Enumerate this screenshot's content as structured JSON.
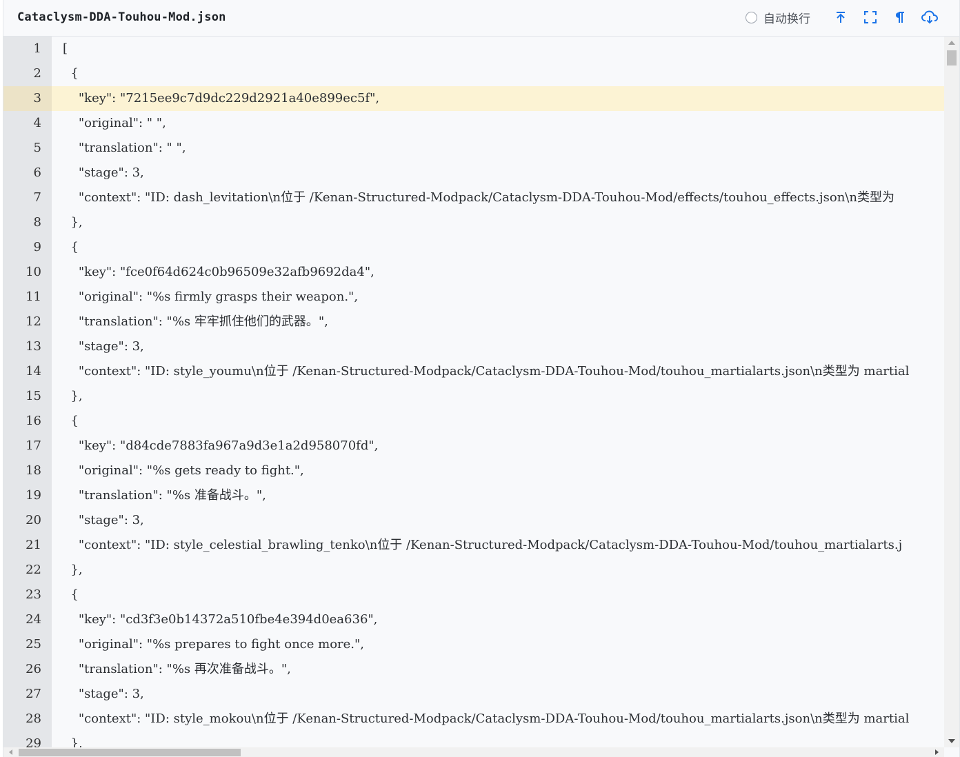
{
  "header": {
    "file_title": "Cataclysm-DDA-Touhou-Mod.json",
    "wrap_label": "自动换行",
    "wrap_checked": false,
    "tools": [
      "scroll-to-top-icon",
      "fullscreen-icon",
      "pilcrow-icon",
      "cloud-download-icon"
    ]
  },
  "colors": {
    "accent": "#1a73e8",
    "active_line": "#fcf3d4",
    "gutter": "#e4e6e9"
  },
  "editor": {
    "active_line": 3,
    "lines": [
      "[",
      "  {",
      "    \"key\": \"7215ee9c7d9dc229d2921a40e899ec5f\",",
      "    \"original\": \" \",",
      "    \"translation\": \" \",",
      "    \"stage\": 3,",
      "    \"context\": \"ID: dash_levitation\\n位于 /Kenan-Structured-Modpack/Cataclysm-DDA-Touhou-Mod/effects/touhou_effects.json\\n类型为",
      "  },",
      "  {",
      "    \"key\": \"fce0f64d624c0b96509e32afb9692da4\",",
      "    \"original\": \"%s firmly grasps their weapon.\",",
      "    \"translation\": \"%s 牢牢抓住他们的武器。\",",
      "    \"stage\": 3,",
      "    \"context\": \"ID: style_youmu\\n位于 /Kenan-Structured-Modpack/Cataclysm-DDA-Touhou-Mod/touhou_martialarts.json\\n类型为 martial",
      "  },",
      "  {",
      "    \"key\": \"d84cde7883fa967a9d3e1a2d958070fd\",",
      "    \"original\": \"%s gets ready to fight.\",",
      "    \"translation\": \"%s 准备战斗。\",",
      "    \"stage\": 3,",
      "    \"context\": \"ID: style_celestial_brawling_tenko\\n位于 /Kenan-Structured-Modpack/Cataclysm-DDA-Touhou-Mod/touhou_martialarts.j",
      "  },",
      "  {",
      "    \"key\": \"cd3f3e0b14372a510fbe4e394d0ea636\",",
      "    \"original\": \"%s prepares to fight once more.\",",
      "    \"translation\": \"%s 再次准备战斗。\",",
      "    \"stage\": 3,",
      "    \"context\": \"ID: style_mokou\\n位于 /Kenan-Structured-Modpack/Cataclysm-DDA-Touhou-Mod/touhou_martialarts.json\\n类型为 martial",
      "  },"
    ]
  }
}
